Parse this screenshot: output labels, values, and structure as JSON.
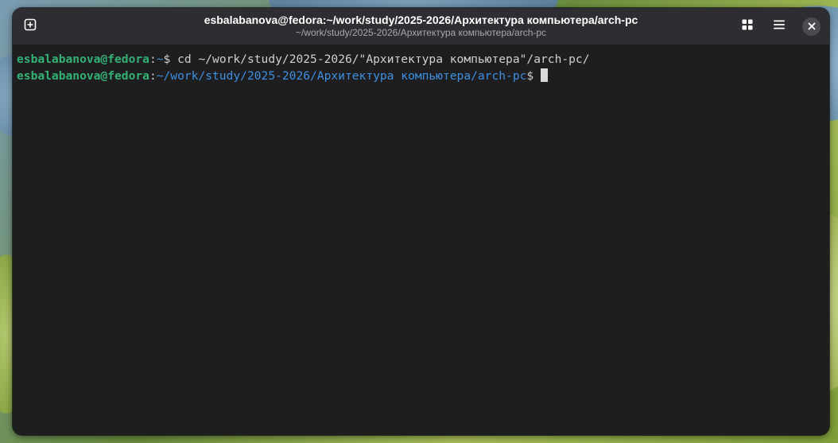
{
  "window": {
    "title": "esbalabanova@fedora:~/work/study/2025-2026/Архитектура компьютера/arch-pc",
    "subtitle": "~/work/study/2025-2026/Архитектура компьютера/arch-pc"
  },
  "titlebar_buttons": {
    "new_tab_icon": "plus-square-icon",
    "tabs_overview_icon": "grid-icon",
    "menu_icon": "hamburger-icon",
    "close_icon": "close-icon"
  },
  "terminal": {
    "lines": [
      {
        "user_host": "esbalabanova@fedora",
        "separator": ":",
        "path": "~",
        "prompt_symbol": "$ ",
        "command": "cd ~/work/study/2025-2026/\"Архитектура компьютера\"/arch-pc/"
      },
      {
        "user_host": "esbalabanova@fedora",
        "separator": ":",
        "path": "~/work/study/2025-2026/Архитектура компьютера/arch-pc",
        "prompt_symbol": "$ ",
        "command": ""
      }
    ]
  },
  "colors": {
    "prompt_user": "#33b074",
    "prompt_path": "#3d8fe0",
    "terminal_bg": "#1e1e20",
    "titlebar_bg": "#2e2e32",
    "text": "#d0d0d0"
  }
}
